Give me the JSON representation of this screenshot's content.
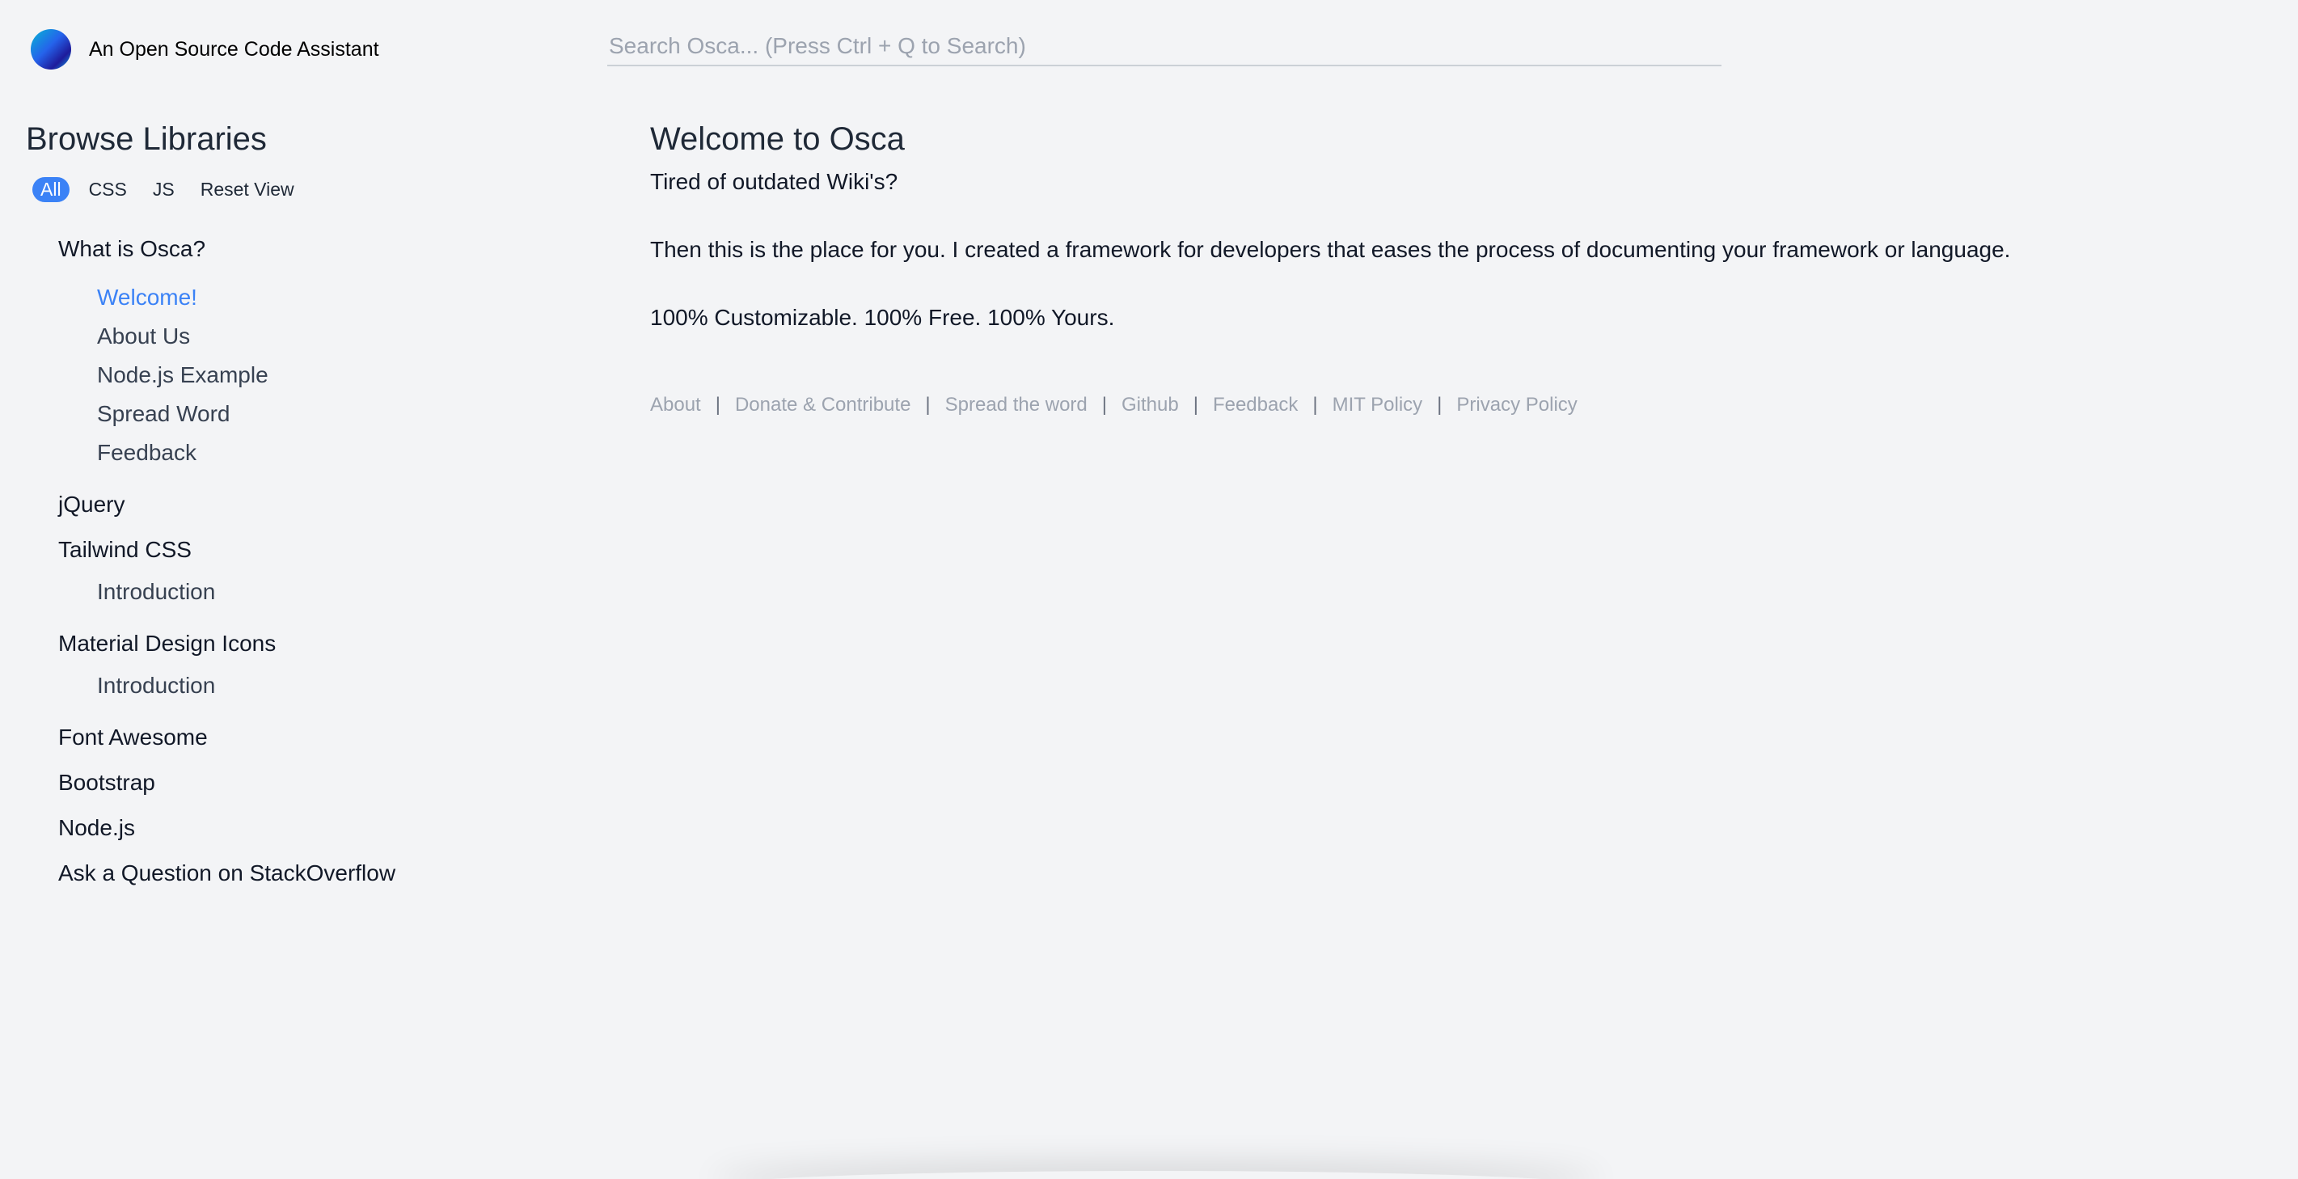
{
  "header": {
    "logo_text": "An Open Source Code Assistant",
    "search_placeholder": "Search Osca... (Press Ctrl + Q to Search)",
    "logo_icon": "gradient-circle-logo"
  },
  "sidebar": {
    "title": "Browse Libraries",
    "filters": [
      "All",
      "CSS",
      "JS",
      "Reset View"
    ],
    "active_filter": "All",
    "groups": [
      {
        "label": "What is Osca?",
        "items": [
          "Welcome!",
          "About Us",
          "Node.js Example",
          "Spread Word",
          "Feedback"
        ],
        "active_item": "Welcome!"
      },
      {
        "label": "jQuery",
        "items": []
      },
      {
        "label": "Tailwind CSS",
        "items": [
          "Introduction"
        ]
      },
      {
        "label": "Material Design Icons",
        "items": [
          "Introduction"
        ]
      },
      {
        "label": "Font Awesome",
        "items": []
      },
      {
        "label": "Bootstrap",
        "items": []
      },
      {
        "label": "Node.js",
        "items": []
      },
      {
        "label": "Ask a Question on StackOverflow",
        "items": []
      }
    ]
  },
  "main": {
    "title": "Welcome to Osca",
    "line1": "Tired of outdated Wiki's?",
    "line2": "Then this is the place for you. I created a framework for developers that eases the process of documenting your framework or language.",
    "line3": "100% Customizable. 100% Free. 100% Yours."
  },
  "footer": {
    "links": [
      "About",
      "Donate & Contribute",
      "Spread the word",
      "Github",
      "Feedback",
      "MIT Policy",
      "Privacy Policy"
    ],
    "separator": "|"
  },
  "colors": {
    "background": "#f3f4f6",
    "accent": "#3b82f6",
    "muted": "#9ca3af"
  }
}
